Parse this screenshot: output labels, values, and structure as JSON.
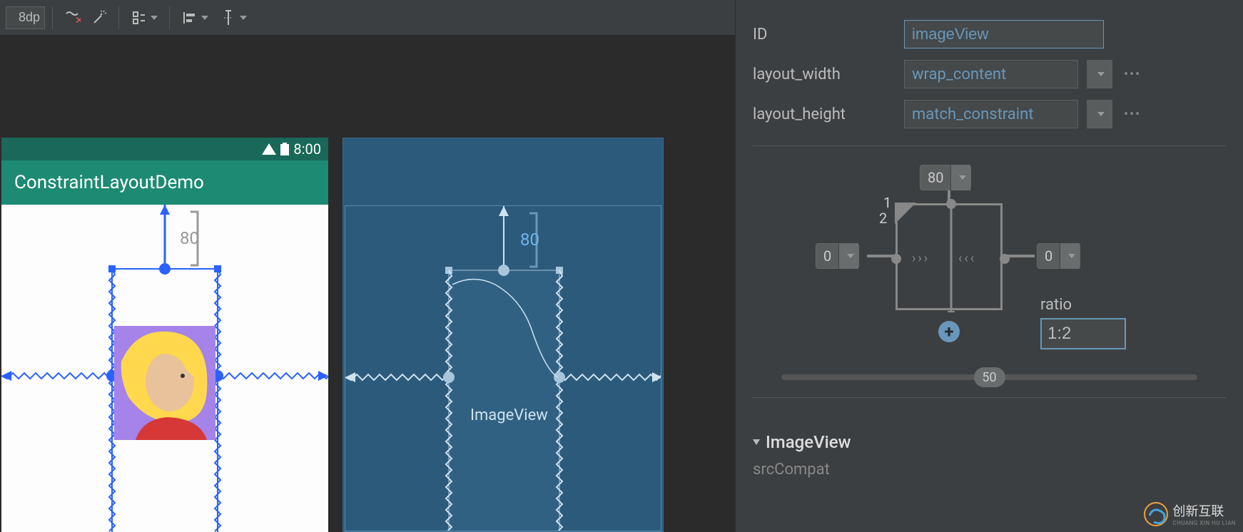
{
  "toolbar": {
    "default_margin": "8dp"
  },
  "preview": {
    "status_time": "8:00",
    "app_title": "ConstraintLayoutDemo",
    "margin_top": "80",
    "selected_view": "ImageView"
  },
  "blueprint": {
    "margin_top": "80",
    "view_label": "ImageView"
  },
  "attributes": {
    "id_label": "ID",
    "id_value": "imageView",
    "layout_width_label": "layout_width",
    "layout_width_value": "wrap_content",
    "layout_height_label": "layout_height",
    "layout_height_value": "match_constraint",
    "margin_top": "80",
    "margin_left": "0",
    "margin_right": "0",
    "ratio_label": "ratio",
    "ratio_value": "1:2",
    "ratio_corner_1": "1",
    "ratio_corner_2": "2",
    "bias": "50",
    "section_title": "ImageView",
    "src_compat_label": "srcCompat"
  },
  "watermark": {
    "brand": "创新互联",
    "sub": "CHUANG XIN HU LIAN"
  }
}
